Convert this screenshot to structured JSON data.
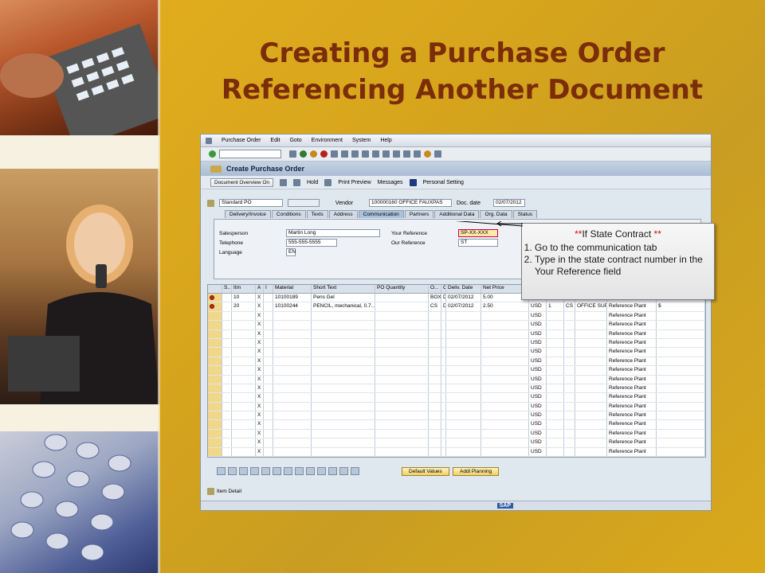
{
  "slide": {
    "title_line1": "Creating a Purchase Order",
    "title_line2": "Referencing Another Document"
  },
  "sap": {
    "menu": [
      "Purchase Order",
      "Edit",
      "Goto",
      "Environment",
      "System",
      "Help"
    ],
    "screen_title": "Create Purchase Order",
    "app_toolbar": [
      "Document Overview On",
      "Hold",
      "Print Preview",
      "Messages",
      "Personal Setting"
    ],
    "header": {
      "doc_type": "Standard PO",
      "vendor_label": "Vendor",
      "vendor_value": "100000160 OFFICE FAUXPAS",
      "doc_date_label": "Doc. date",
      "doc_date_value": "02/07/2012"
    },
    "tabs": [
      "Delivery/Invoice",
      "Conditions",
      "Texts",
      "Address",
      "Communication",
      "Partners",
      "Additional Data",
      "Org. Data",
      "Status"
    ],
    "active_tab": "Communication",
    "communication": {
      "salesperson_label": "Salesperson",
      "salesperson_value": "Martin Long",
      "telephone_label": "Telephone",
      "telephone_value": "555-555-5555",
      "language_label": "Language",
      "language_value": "EN",
      "your_ref_label": "Your Reference",
      "your_ref_value": "SP-XX-XXX",
      "our_ref_label": "Our Reference",
      "our_ref_value": "ST"
    },
    "grid": {
      "columns": [
        "S..",
        "Itm",
        "A",
        "I",
        "Material",
        "Short Text",
        "PO Quantity",
        "O...",
        "C",
        "Deliv. Date",
        "Net Price",
        "C",
        "",
        "",
        "",
        "",
        "",
        ""
      ],
      "rows": [
        [
          "10",
          "X",
          "10100189",
          "Pens Gel",
          "BOX",
          "D",
          "02/07/2012",
          "5.00",
          "USD",
          "1",
          "BOX",
          "OFFICE SUP...",
          "Reference Plant",
          "$"
        ],
        [
          "20",
          "X",
          "10100244",
          "PENCIL, mechanical, 0.7...",
          "CS",
          "D",
          "02/07/2012",
          "2.50",
          "USD",
          "1",
          "CS",
          "OFFICE SUP...",
          "Reference Plant",
          "$"
        ]
      ],
      "empty_row_cols": {
        "a": "X",
        "currency": "USD",
        "plant": "Reference Plant"
      },
      "empty_row_count": 16
    },
    "buttons": {
      "default_values": "Default Values",
      "addl_planning": "Addl Planning"
    },
    "item_detail": "Item Detail",
    "logo": "SAP"
  },
  "callout": {
    "heading": "If State Contract",
    "stars": "**",
    "steps": [
      "Go to the communication tab",
      "Type in the state contract number in the Your Reference field"
    ]
  }
}
